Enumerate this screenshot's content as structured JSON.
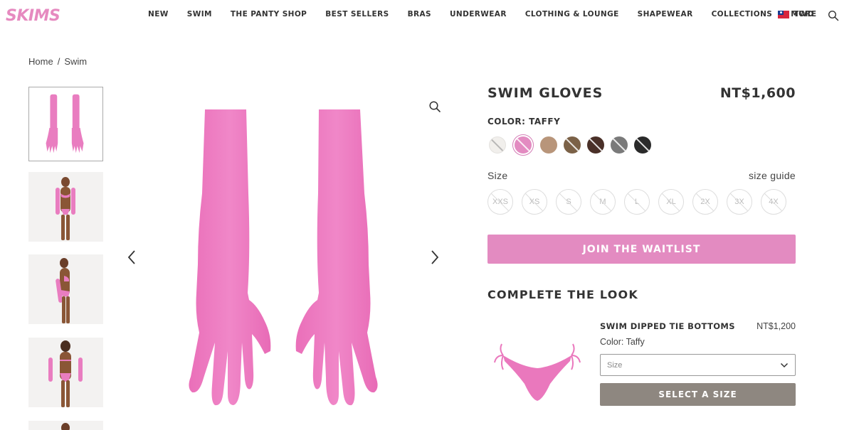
{
  "brand": {
    "logo_text": "SKIMS",
    "brand_color": "#e68ac0"
  },
  "nav": {
    "items": [
      "NEW",
      "SWIM",
      "THE PANTY SHOP",
      "BEST SELLERS",
      "BRAS",
      "UNDERWEAR",
      "CLOTHING & LOUNGE",
      "SHAPEWEAR",
      "COLLECTIONS",
      "MORE"
    ],
    "currency": "TWD",
    "currency_icon": "taiwan-flag-icon",
    "search_icon": "search-icon"
  },
  "breadcrumb": {
    "home": "Home",
    "separator": "/",
    "current": "Swim"
  },
  "gallery": {
    "thumbnails": [
      "gloves-flat-lay",
      "model-front",
      "model-side",
      "model-back",
      "model-partial"
    ],
    "selected_index": 0,
    "zoom_icon": "magnifier-icon",
    "prev_icon": "chevron-left-icon",
    "next_icon": "chevron-right-icon"
  },
  "product": {
    "title": "SWIM GLOVES",
    "price": "NT$1,600",
    "color_label": "COLOR: TAFFY",
    "swatches": [
      {
        "name": "white",
        "color": "#f1efec",
        "unavailable": true
      },
      {
        "name": "taffy",
        "color": "#e38bc1",
        "unavailable": true,
        "selected": true
      },
      {
        "name": "sand",
        "color": "#b8957a",
        "unavailable": false
      },
      {
        "name": "khaki",
        "color": "#7b6147",
        "unavailable": true
      },
      {
        "name": "cocoa",
        "color": "#4a3028",
        "unavailable": true
      },
      {
        "name": "gunmetal",
        "color": "#7a7a7a",
        "unavailable": true
      },
      {
        "name": "onyx",
        "color": "#2a2a2a",
        "unavailable": true
      }
    ],
    "size_label": "Size",
    "size_guide": "size guide",
    "sizes": [
      "XXS",
      "XS",
      "S",
      "M",
      "L",
      "XL",
      "2X",
      "3X",
      "4X"
    ],
    "cta": "JOIN THE WAITLIST",
    "cta_color": "#e38bc1"
  },
  "complete_the_look": {
    "heading": "COMPLETE THE LOOK",
    "item": {
      "name": "SWIM DIPPED TIE BOTTOMS",
      "price": "NT$1,200",
      "color": "Color: Taffy",
      "select_placeholder": "Size",
      "button": "SELECT A SIZE",
      "button_color": "#8e8780"
    }
  }
}
